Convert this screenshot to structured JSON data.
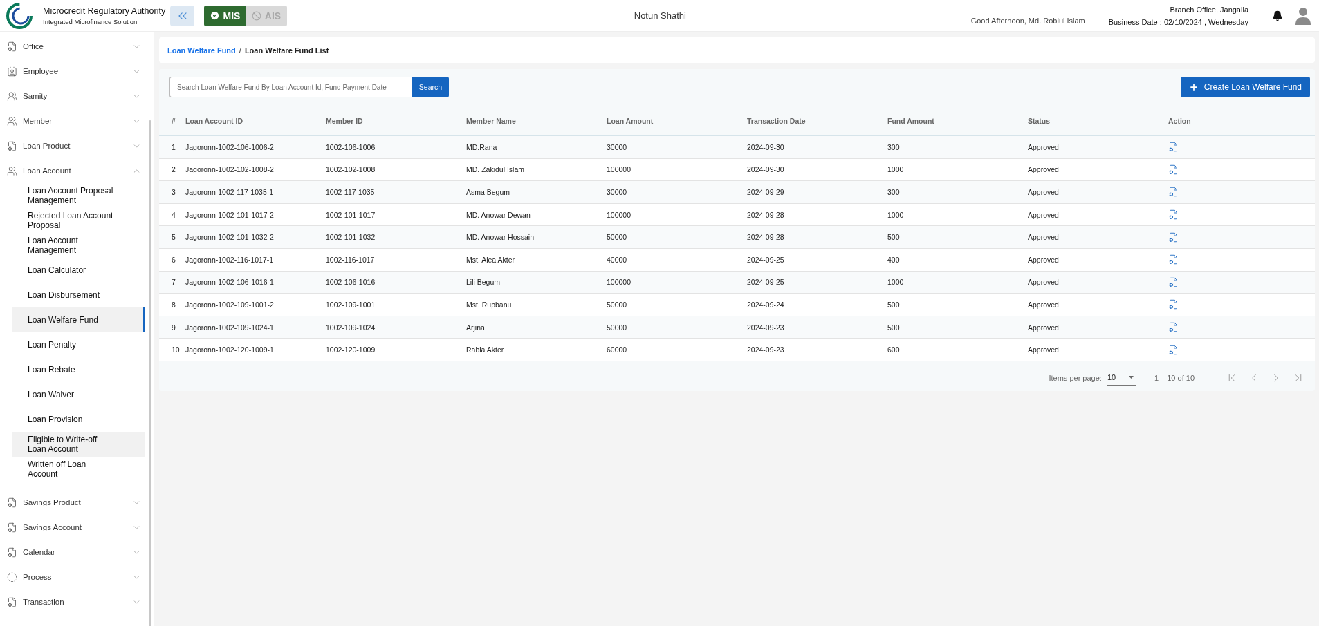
{
  "header": {
    "title": "Microcredit Regulatory Authority",
    "subtitle": "Integrated Microfinance Solution",
    "modes": [
      {
        "label": "MIS",
        "selected": true
      },
      {
        "label": "AIS",
        "selected": false
      }
    ],
    "app_name": "Notun Shathi",
    "greeting": "Good Afternoon, Md. Robiul Islam",
    "branch": "Branch Office, Jangalia",
    "business_date": "Business Date : 02/10/2024 , Wednesday"
  },
  "sidebar": {
    "items": [
      {
        "label": "Office",
        "kind": "document",
        "expanded": false
      },
      {
        "label": "Employee",
        "kind": "badge",
        "expanded": false
      },
      {
        "label": "Samity",
        "kind": "samity",
        "expanded": false
      },
      {
        "label": "Member",
        "kind": "people",
        "expanded": false
      },
      {
        "label": "Loan Product",
        "kind": "document",
        "expanded": false
      },
      {
        "label": "Loan Account",
        "kind": "people",
        "expanded": true,
        "children": [
          {
            "label": "Loan Account Proposal Management",
            "selected": false,
            "highlighted": false
          },
          {
            "label": "Rejected Loan Account Proposal",
            "selected": false,
            "highlighted": false
          },
          {
            "label": "Loan Account Management",
            "selected": false,
            "highlighted": false
          },
          {
            "label": "Loan Calculator",
            "selected": false,
            "highlighted": false
          },
          {
            "label": "Loan Disbursement",
            "selected": false,
            "highlighted": false
          },
          {
            "label": "Loan Welfare Fund",
            "selected": true,
            "highlighted": true
          },
          {
            "label": "Loan Penalty",
            "selected": false,
            "highlighted": false
          },
          {
            "label": "Loan Rebate",
            "selected": false,
            "highlighted": false
          },
          {
            "label": "Loan Waiver",
            "selected": false,
            "highlighted": false
          },
          {
            "label": "Loan Provision",
            "selected": false,
            "highlighted": false
          },
          {
            "label": "Eligible to Write-off Loan Account",
            "selected": false,
            "highlighted": true
          },
          {
            "label": "Written off Loan Account",
            "selected": false,
            "highlighted": false
          }
        ]
      },
      {
        "label": "Savings Product",
        "kind": "document",
        "expanded": false
      },
      {
        "label": "Savings Account",
        "kind": "document",
        "expanded": false
      },
      {
        "label": "Calendar",
        "kind": "document",
        "expanded": false
      },
      {
        "label": "Process",
        "kind": "process",
        "expanded": false
      },
      {
        "label": "Transaction",
        "kind": "document",
        "expanded": false
      }
    ]
  },
  "breadcrumb": {
    "link": "Loan Welfare Fund",
    "separator": "/",
    "current": "Loan Welfare Fund List"
  },
  "search": {
    "placeholder": "Search Loan Welfare Fund By Loan Account Id, Fund Payment Date",
    "button": "Search"
  },
  "create_button": "Create Loan Welfare Fund",
  "table": {
    "columns": [
      "#",
      "Loan Account ID",
      "Member ID",
      "Member Name",
      "Loan Amount",
      "Transaction Date",
      "Fund Amount",
      "Status",
      "Action"
    ],
    "rows": [
      [
        "1",
        "Jagoronn-1002-106-1006-2",
        "1002-106-1006",
        "MD.Rana",
        "30000",
        "2024-09-30",
        "300",
        "Approved"
      ],
      [
        "2",
        "Jagoronn-1002-102-1008-2",
        "1002-102-1008",
        "MD. Zakidul Islam",
        "100000",
        "2024-09-30",
        "1000",
        "Approved"
      ],
      [
        "3",
        "Jagoronn-1002-117-1035-1",
        "1002-117-1035",
        "Asma Begum",
        "30000",
        "2024-09-29",
        "300",
        "Approved"
      ],
      [
        "4",
        "Jagoronn-1002-101-1017-2",
        "1002-101-1017",
        "MD. Anowar Dewan",
        "100000",
        "2024-09-28",
        "1000",
        "Approved"
      ],
      [
        "5",
        "Jagoronn-1002-101-1032-2",
        "1002-101-1032",
        "MD. Anowar Hossain",
        "50000",
        "2024-09-28",
        "500",
        "Approved"
      ],
      [
        "6",
        "Jagoronn-1002-116-1017-1",
        "1002-116-1017",
        "Mst. Alea Akter",
        "40000",
        "2024-09-25",
        "400",
        "Approved"
      ],
      [
        "7",
        "Jagoronn-1002-106-1016-1",
        "1002-106-1016",
        "Lili Begum",
        "100000",
        "2024-09-25",
        "1000",
        "Approved"
      ],
      [
        "8",
        "Jagoronn-1002-109-1001-2",
        "1002-109-1001",
        "Mst. Rupbanu",
        "50000",
        "2024-09-24",
        "500",
        "Approved"
      ],
      [
        "9",
        "Jagoronn-1002-109-1024-1",
        "1002-109-1024",
        "Arjina",
        "50000",
        "2024-09-23",
        "500",
        "Approved"
      ],
      [
        "10",
        "Jagoronn-1002-120-1009-1",
        "1002-120-1009",
        "Rabia Akter",
        "60000",
        "2024-09-23",
        "600",
        "Approved"
      ]
    ]
  },
  "pagination": {
    "label": "Items per page:",
    "per_page": "10",
    "range": "1 – 10 of 10"
  }
}
